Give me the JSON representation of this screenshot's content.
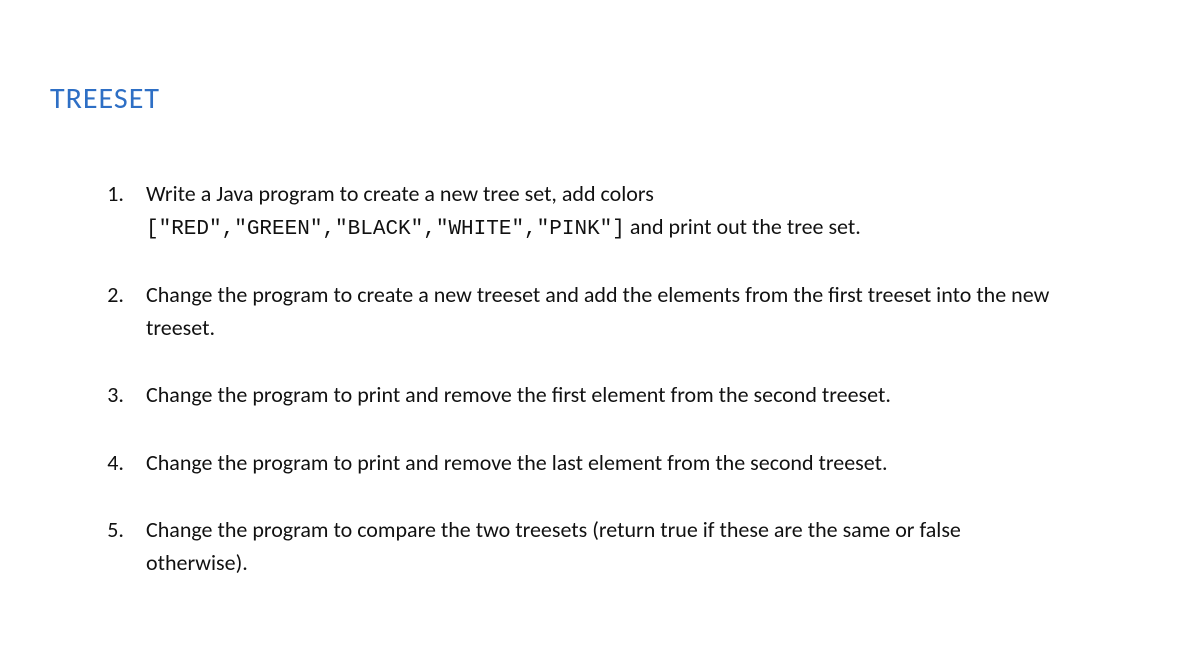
{
  "heading": "TREESET",
  "items": [
    {
      "num": "1.",
      "pre": "Write a Java program to create a new tree set, add colors ",
      "code": "[\"RED\",\"GREEN\",\"BLACK\",\"WHITE\",\"PINK\"]",
      "post": " and print out the tree set."
    },
    {
      "num": "2.",
      "pre": "Change the program to create a new treeset and add the elements from the first treeset into the new treeset.",
      "code": "",
      "post": ""
    },
    {
      "num": "3.",
      "pre": "Change the program to print and remove the first element from the second treeset.",
      "code": "",
      "post": ""
    },
    {
      "num": "4.",
      "pre": "Change the program to print and remove the last element from the second treeset.",
      "code": "",
      "post": ""
    },
    {
      "num": "5.",
      "pre": "Change the program to compare the two treesets (return true if these are the same or false otherwise).",
      "code": "",
      "post": ""
    }
  ]
}
